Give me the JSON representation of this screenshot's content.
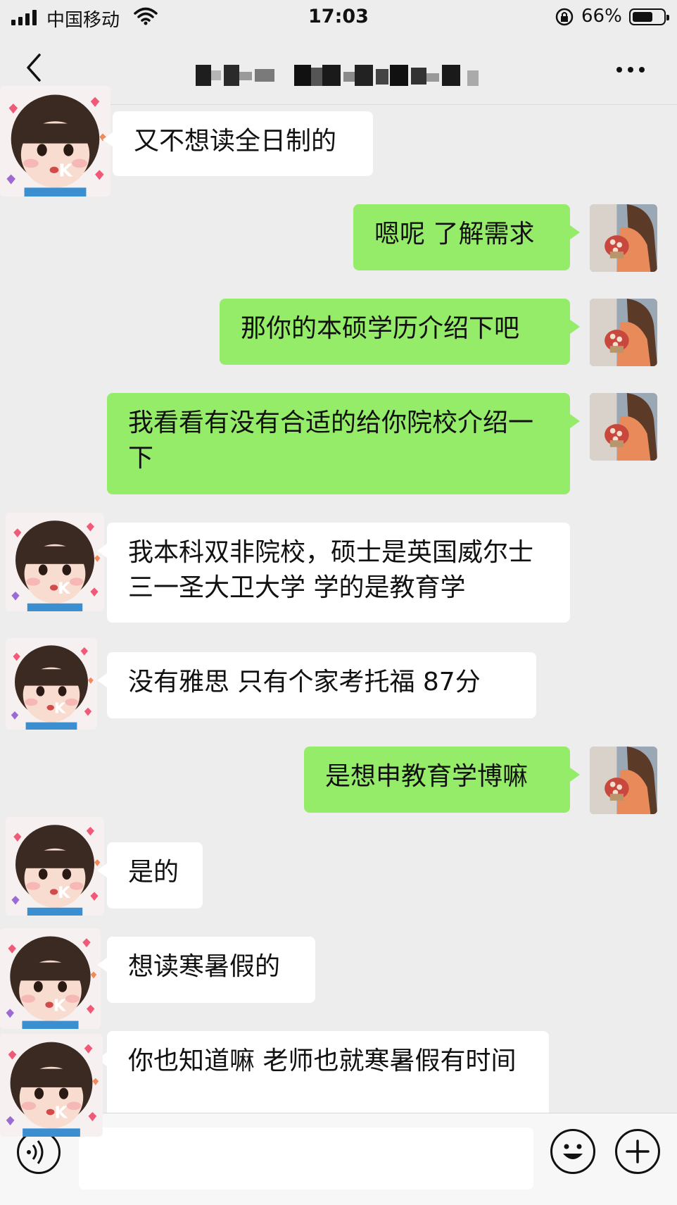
{
  "status_bar": {
    "carrier": "中国移动",
    "time": "17:03",
    "battery_percent": "66%",
    "battery_level": 0.66
  },
  "nav": {
    "back_icon": "chevron-left-icon",
    "title_obscured": true,
    "more_icon": "ellipsis-icon"
  },
  "messages": [
    {
      "side": "in",
      "text": "又不想读全日制的"
    },
    {
      "side": "out",
      "text": "嗯呢 了解需求"
    },
    {
      "side": "out",
      "text": "那你的本硕学历介绍下吧"
    },
    {
      "side": "out",
      "text": "我看看有没有合适的给你院校介绍一下"
    },
    {
      "side": "in",
      "text": "我本科双非院校，硕士是英国威尔士三一圣大卫大学 学的是教育学"
    },
    {
      "side": "in",
      "text": "没有雅思 只有个家考托福 87分"
    },
    {
      "side": "out",
      "text": "是想申教育学博嘛"
    },
    {
      "side": "in",
      "text": "是的"
    },
    {
      "side": "in",
      "text": "想读寒暑假的"
    },
    {
      "side": "in",
      "text": "你也知道嘛 老师也就寒暑假有时间"
    }
  ],
  "input_bar": {
    "voice_icon": "voice-icon",
    "emoji_icon": "emoji-icon",
    "plus_icon": "plus-icon"
  }
}
